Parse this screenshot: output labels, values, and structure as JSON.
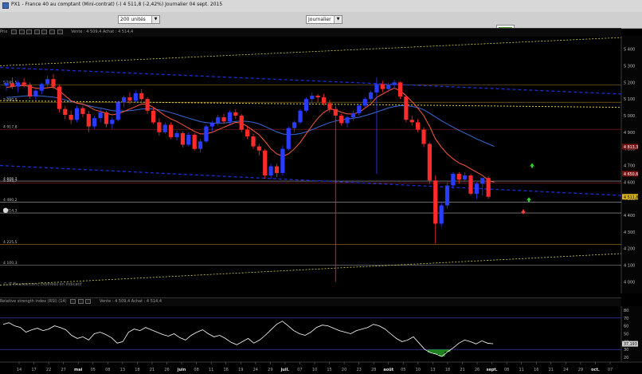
{
  "window": {
    "title": "PX1 - France 40 au comptant (Mini-contrat)  (-)   4 511,8 (-2,42%)   Journalier  04 sept. 2015"
  },
  "toolbar": {
    "units_select": "200 unités",
    "period_select": "Journalier",
    "logo_icon": "chart-logo-icon"
  },
  "main_panel": {
    "prefix": "Prix",
    "quote": "Vente : 4 509,4  Achat : 4 514,4",
    "watermark": "© IT-Finance.com, Données en indicatif"
  },
  "rsi_panel": {
    "title": "Relative strength index (RSI) (14)",
    "quote": "Vente : 4 509,4  Achat : 4 514,4",
    "value_badge": "37,193"
  },
  "price_axis": {
    "labels": [
      "5 400",
      "5 300",
      "5 200",
      "5 100",
      "5 000",
      "4 900",
      "4 800",
      "4 700",
      "4 600",
      "4 500",
      "4 400",
      "4 300",
      "4 200",
      "4 100",
      "4 000"
    ],
    "badges": [
      "4 813,3",
      "4 650,6",
      "4 511,8"
    ]
  },
  "rsi_axis": {
    "labels": [
      "80",
      "70",
      "60",
      "50",
      "40",
      "30",
      "20"
    ]
  },
  "level_labels": [
    "5 185,5",
    "5 080,9",
    "4 917,8",
    "4 595,7",
    "4 606,2",
    "4 480,2",
    "4 414,3",
    "4 225,5",
    "4 100,3"
  ],
  "time_axis": {
    "labels": [
      "14",
      "17",
      "22",
      "27",
      "mai",
      "05",
      "08",
      "13",
      "18",
      "21",
      "26",
      "juin",
      "08",
      "11",
      "16",
      "19",
      "24",
      "29",
      "juil.",
      "07",
      "10",
      "15",
      "20",
      "23",
      "28",
      "août",
      "05",
      "10",
      "13",
      "18",
      "21",
      "26",
      "sept.",
      "08",
      "11",
      "16",
      "21",
      "24",
      "29",
      "oct.",
      "07"
    ]
  },
  "colors": {
    "up_candle": "#2a3cff",
    "down_candle": "#ff2a2a",
    "ma_fast": "#ff5a3c",
    "ma_slow": "#3a6ad8",
    "trend_blue": "#1a2fd0",
    "trend_yellow": "#d8cf55",
    "support_red": "#a62828",
    "support_gold": "#b88c2a",
    "rsi_line": "#ffffff",
    "rsi_fill": "#1f8a1f"
  },
  "chart_data": {
    "type": "candlestick",
    "instrument": "PX1 - France 40 au comptant (Mini-contrat)",
    "ylim": [
      3930,
      5480
    ],
    "last_close": 4511.8,
    "candles": [
      {
        "o": 5180,
        "h": 5215,
        "l": 5150,
        "c": 5195
      },
      {
        "o": 5195,
        "h": 5230,
        "l": 5160,
        "c": 5175
      },
      {
        "o": 5175,
        "h": 5210,
        "l": 5140,
        "c": 5200
      },
      {
        "o": 5200,
        "h": 5225,
        "l": 5170,
        "c": 5185
      },
      {
        "o": 5185,
        "h": 5200,
        "l": 5100,
        "c": 5115
      },
      {
        "o": 5115,
        "h": 5160,
        "l": 5095,
        "c": 5150
      },
      {
        "o": 5150,
        "h": 5200,
        "l": 5130,
        "c": 5190
      },
      {
        "o": 5190,
        "h": 5240,
        "l": 5170,
        "c": 5220
      },
      {
        "o": 5220,
        "h": 5250,
        "l": 5160,
        "c": 5175
      },
      {
        "o": 5175,
        "h": 5185,
        "l": 5020,
        "c": 5040
      },
      {
        "o": 5040,
        "h": 5060,
        "l": 4980,
        "c": 5005
      },
      {
        "o": 5005,
        "h": 5030,
        "l": 4950,
        "c": 4975
      },
      {
        "o": 4975,
        "h": 5060,
        "l": 4960,
        "c": 5045
      },
      {
        "o": 5045,
        "h": 5060,
        "l": 4990,
        "c": 5010
      },
      {
        "o": 5010,
        "h": 5030,
        "l": 4900,
        "c": 4935
      },
      {
        "o": 4935,
        "h": 5000,
        "l": 4920,
        "c": 4985
      },
      {
        "o": 4985,
        "h": 5040,
        "l": 4960,
        "c": 5020
      },
      {
        "o": 5020,
        "h": 5030,
        "l": 4930,
        "c": 4950
      },
      {
        "o": 4950,
        "h": 4990,
        "l": 4920,
        "c": 4975
      },
      {
        "o": 4975,
        "h": 5090,
        "l": 4965,
        "c": 5080
      },
      {
        "o": 5080,
        "h": 5120,
        "l": 5050,
        "c": 5110
      },
      {
        "o": 5110,
        "h": 5140,
        "l": 5070,
        "c": 5090
      },
      {
        "o": 5090,
        "h": 5150,
        "l": 5080,
        "c": 5135
      },
      {
        "o": 5135,
        "h": 5160,
        "l": 5090,
        "c": 5100
      },
      {
        "o": 5100,
        "h": 5110,
        "l": 5010,
        "c": 5030
      },
      {
        "o": 5030,
        "h": 5050,
        "l": 4950,
        "c": 4960
      },
      {
        "o": 4960,
        "h": 4985,
        "l": 4880,
        "c": 4900
      },
      {
        "o": 4900,
        "h": 4960,
        "l": 4890,
        "c": 4945
      },
      {
        "o": 4945,
        "h": 4960,
        "l": 4860,
        "c": 4870
      },
      {
        "o": 4870,
        "h": 4910,
        "l": 4850,
        "c": 4895
      },
      {
        "o": 4895,
        "h": 4905,
        "l": 4810,
        "c": 4825
      },
      {
        "o": 4825,
        "h": 4900,
        "l": 4815,
        "c": 4885
      },
      {
        "o": 4885,
        "h": 4895,
        "l": 4790,
        "c": 4800
      },
      {
        "o": 4800,
        "h": 4860,
        "l": 4780,
        "c": 4845
      },
      {
        "o": 4845,
        "h": 4945,
        "l": 4835,
        "c": 4935
      },
      {
        "o": 4935,
        "h": 4970,
        "l": 4905,
        "c": 4955
      },
      {
        "o": 4955,
        "h": 5005,
        "l": 4940,
        "c": 4990
      },
      {
        "o": 4990,
        "h": 5010,
        "l": 4950,
        "c": 4965
      },
      {
        "o": 4965,
        "h": 5030,
        "l": 4950,
        "c": 5020
      },
      {
        "o": 5020,
        "h": 5040,
        "l": 4980,
        "c": 5000
      },
      {
        "o": 5000,
        "h": 5010,
        "l": 4900,
        "c": 4915
      },
      {
        "o": 4915,
        "h": 4940,
        "l": 4860,
        "c": 4875
      },
      {
        "o": 4875,
        "h": 4890,
        "l": 4800,
        "c": 4815
      },
      {
        "o": 4815,
        "h": 4830,
        "l": 4760,
        "c": 4790
      },
      {
        "o": 4790,
        "h": 4800,
        "l": 4620,
        "c": 4640
      },
      {
        "o": 4640,
        "h": 4710,
        "l": 4620,
        "c": 4695
      },
      {
        "o": 4695,
        "h": 4710,
        "l": 4630,
        "c": 4655
      },
      {
        "o": 4655,
        "h": 4820,
        "l": 4640,
        "c": 4800
      },
      {
        "o": 4800,
        "h": 4935,
        "l": 4790,
        "c": 4925
      },
      {
        "o": 4925,
        "h": 4970,
        "l": 4900,
        "c": 4960
      },
      {
        "o": 4960,
        "h": 5040,
        "l": 4950,
        "c": 5030
      },
      {
        "o": 5030,
        "h": 5110,
        "l": 5020,
        "c": 5100
      },
      {
        "o": 5100,
        "h": 5140,
        "l": 5070,
        "c": 5120
      },
      {
        "o": 5120,
        "h": 5130,
        "l": 5080,
        "c": 5110
      },
      {
        "o": 5110,
        "h": 5130,
        "l": 5060,
        "c": 5075
      },
      {
        "o": 5075,
        "h": 5095,
        "l": 5020,
        "c": 5040
      },
      {
        "o": 5040,
        "h": 5060,
        "l": 4000,
        "c": 5000
      },
      {
        "o": 5000,
        "h": 5010,
        "l": 4940,
        "c": 4955
      },
      {
        "o": 4955,
        "h": 5000,
        "l": 4930,
        "c": 4990
      },
      {
        "o": 4990,
        "h": 5030,
        "l": 4970,
        "c": 5015
      },
      {
        "o": 5015,
        "h": 5070,
        "l": 5000,
        "c": 5060
      },
      {
        "o": 5060,
        "h": 5110,
        "l": 5050,
        "c": 5100
      },
      {
        "o": 5100,
        "h": 5150,
        "l": 5080,
        "c": 5140
      },
      {
        "o": 5140,
        "h": 5230,
        "l": 4650,
        "c": 5190
      },
      {
        "o": 5190,
        "h": 5210,
        "l": 5140,
        "c": 5160
      },
      {
        "o": 5160,
        "h": 5200,
        "l": 5140,
        "c": 5185
      },
      {
        "o": 5185,
        "h": 5215,
        "l": 5160,
        "c": 5200
      },
      {
        "o": 5200,
        "h": 5205,
        "l": 5100,
        "c": 5115
      },
      {
        "o": 5115,
        "h": 5120,
        "l": 4960,
        "c": 4975
      },
      {
        "o": 4975,
        "h": 5000,
        "l": 4940,
        "c": 4960
      },
      {
        "o": 4960,
        "h": 4980,
        "l": 4900,
        "c": 4915
      },
      {
        "o": 4915,
        "h": 4930,
        "l": 4810,
        "c": 4830
      },
      {
        "o": 4830,
        "h": 4840,
        "l": 4590,
        "c": 4610
      },
      {
        "o": 4610,
        "h": 4640,
        "l": 4230,
        "c": 4350
      },
      {
        "o": 4350,
        "h": 4480,
        "l": 4330,
        "c": 4460
      },
      {
        "o": 4460,
        "h": 4600,
        "l": 4440,
        "c": 4580
      },
      {
        "o": 4580,
        "h": 4660,
        "l": 4560,
        "c": 4650
      },
      {
        "o": 4650,
        "h": 4660,
        "l": 4590,
        "c": 4615
      },
      {
        "o": 4615,
        "h": 4660,
        "l": 4600,
        "c": 4640
      },
      {
        "o": 4640,
        "h": 4650,
        "l": 4520,
        "c": 4530
      },
      {
        "o": 4530,
        "h": 4600,
        "l": 4500,
        "c": 4590
      },
      {
        "o": 4590,
        "h": 4620,
        "l": 4520,
        "c": 4625
      },
      {
        "o": 4625,
        "h": 4635,
        "l": 4500,
        "c": 4511.8
      }
    ],
    "ma_fast": [
      5170,
      5175,
      5180,
      5182,
      5175,
      5165,
      5162,
      5168,
      5172,
      5150,
      5120,
      5090,
      5075,
      5070,
      5055,
      5035,
      5025,
      5015,
      5005,
      5012,
      5025,
      5040,
      5055,
      5070,
      5068,
      5050,
      5025,
      5000,
      4980,
      4965,
      4945,
      4925,
      4905,
      4890,
      4890,
      4900,
      4915,
      4930,
      4945,
      4960,
      4955,
      4935,
      4910,
      4885,
      4845,
      4800,
      4770,
      4755,
      4770,
      4800,
      4840,
      4890,
      4940,
      4985,
      5020,
      5040,
      5035,
      5020,
      5010,
      5010,
      5020,
      5045,
      5070,
      5110,
      5130,
      5150,
      5165,
      5150,
      5120,
      5085,
      5045,
      5000,
      4935,
      4860,
      4810,
      4770,
      4740,
      4715,
      4700,
      4680,
      4660,
      4640,
      4610,
      4600
    ],
    "ma_slow": [
      5110,
      5112,
      5115,
      5118,
      5120,
      5120,
      5118,
      5115,
      5112,
      5105,
      5095,
      5085,
      5075,
      5068,
      5060,
      5052,
      5045,
      5038,
      5030,
      5028,
      5028,
      5030,
      5034,
      5040,
      5042,
      5040,
      5035,
      5028,
      5018,
      5008,
      4996,
      4985,
      4974,
      4964,
      4958,
      4955,
      4955,
      4956,
      4960,
      4965,
      4967,
      4965,
      4960,
      4950,
      4935,
      4918,
      4902,
      4890,
      4885,
      4887,
      4892,
      4902,
      4915,
      4930,
      4945,
      4958,
      4968,
      4975,
      4980,
      4985,
      4990,
      5000,
      5010,
      5022,
      5034,
      5046,
      5055,
      5060,
      5060,
      5056,
      5048,
      5035,
      5015,
      4992,
      4970,
      4950,
      4930,
      4912,
      4895,
      4878,
      4860,
      4845,
      4830,
      4815
    ],
    "levels": [
      5185.5,
      5080.9,
      4917.8,
      4595.7,
      4606.2,
      4480.2,
      4414.3,
      4225.5,
      4100.3
    ],
    "rsi": {
      "ylim": [
        15,
        85
      ],
      "values": [
        62,
        64,
        60,
        58,
        52,
        55,
        57,
        54,
        56,
        60,
        58,
        55,
        48,
        44,
        46,
        42,
        50,
        52,
        49,
        45,
        38,
        40,
        52,
        56,
        54,
        58,
        55,
        52,
        49,
        47,
        50,
        45,
        42,
        48,
        52,
        55,
        50,
        46,
        48,
        44,
        39,
        36,
        40,
        44,
        38,
        42,
        48,
        55,
        62,
        66,
        60,
        54,
        50,
        48,
        52,
        58,
        61,
        60,
        57,
        54,
        52,
        50,
        54,
        56,
        58,
        62,
        60,
        56,
        50,
        44,
        40,
        42,
        46,
        38,
        30,
        26,
        24,
        21,
        27,
        32,
        38,
        42,
        40,
        37,
        41,
        38,
        37.2
      ]
    }
  }
}
